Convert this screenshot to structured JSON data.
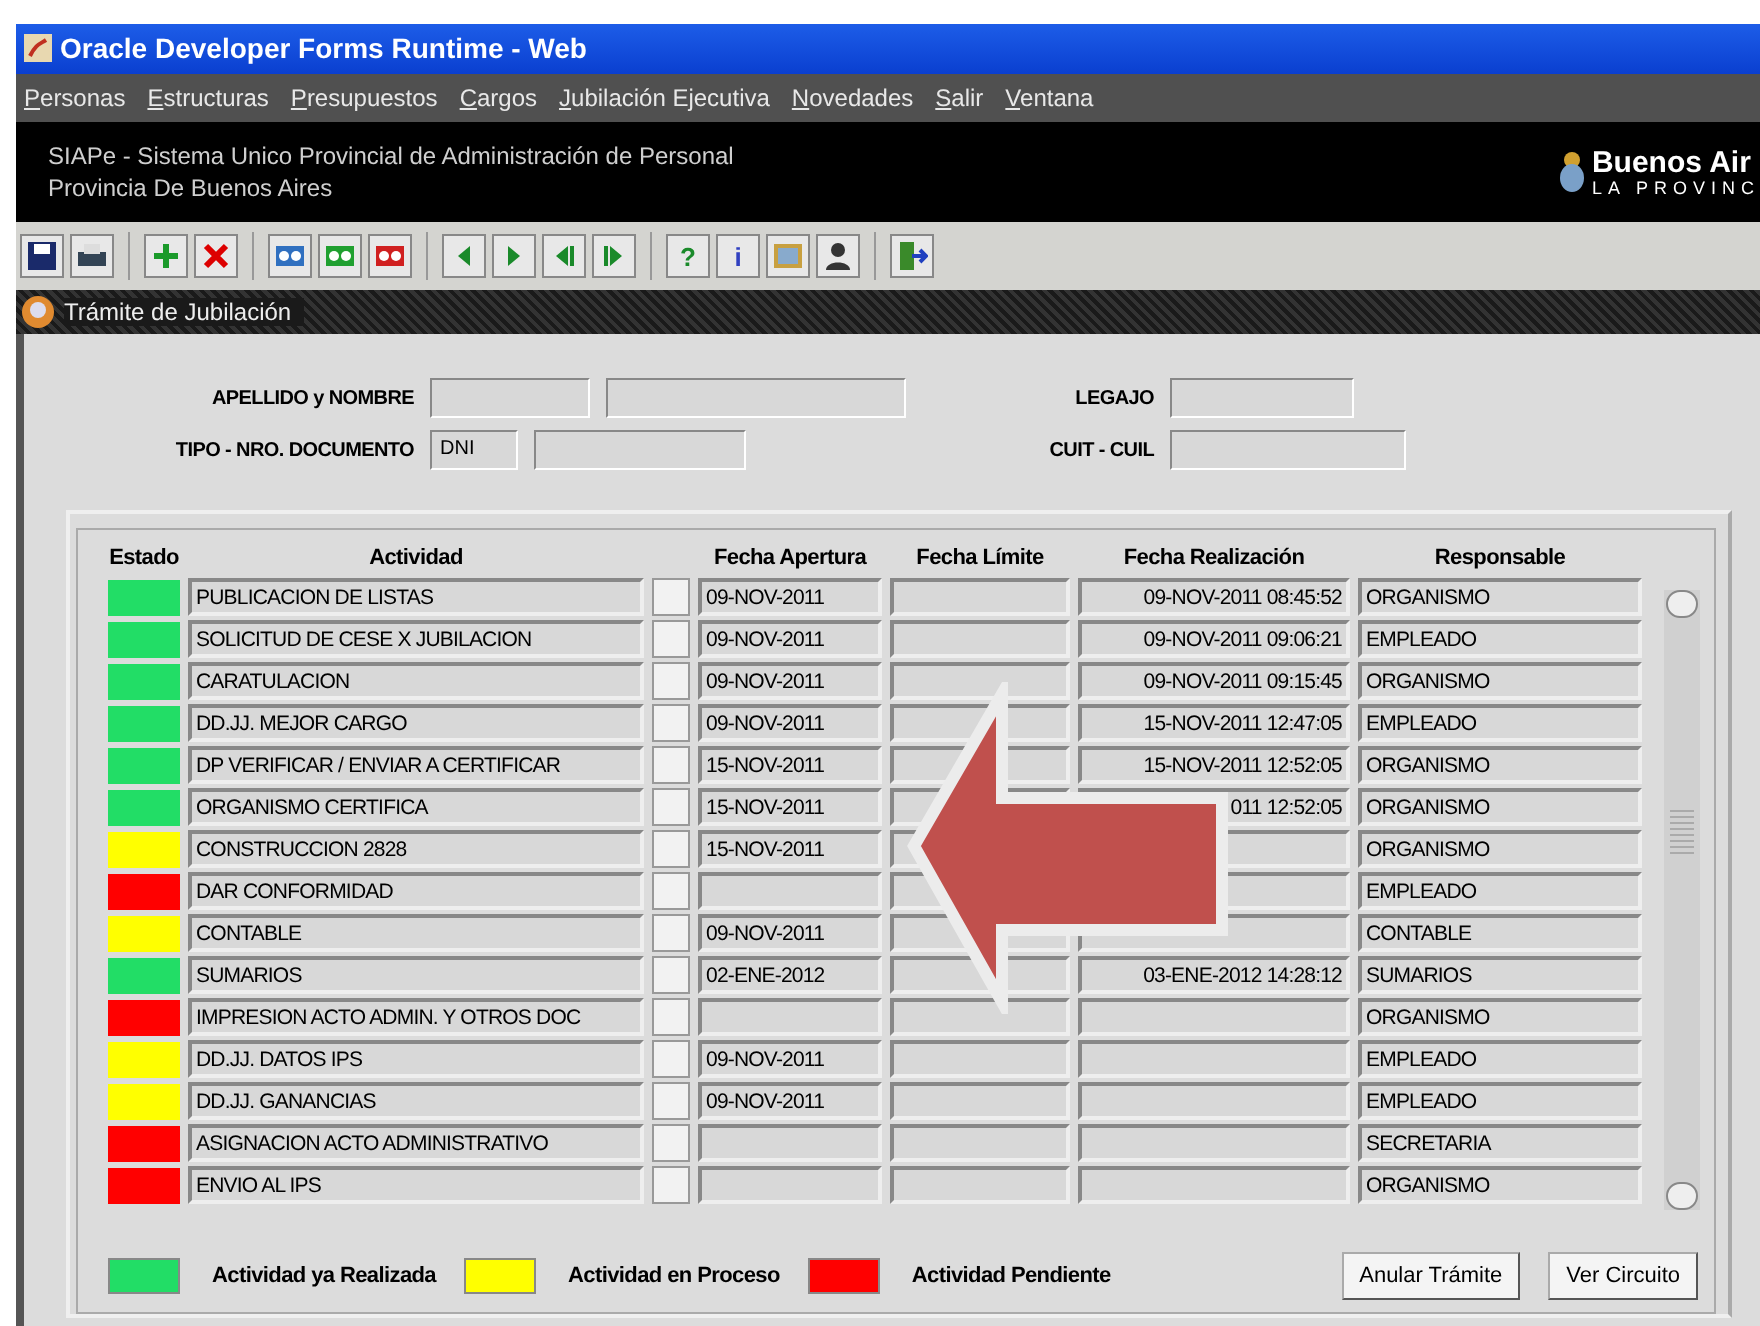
{
  "window": {
    "title": "Oracle Developer Forms Runtime - Web"
  },
  "menu": [
    "Personas",
    "Estructuras",
    "Presupuestos",
    "Cargos",
    "Jubilación Ejecutiva",
    "Novedades",
    "Salir",
    "Ventana"
  ],
  "header": {
    "line1": "SIAPe - Sistema Unico Provincial de Administración de Personal",
    "line2": "Provincia De Buenos Aires",
    "logo_line1": "Buenos Air",
    "logo_line2": "LA PROVINC"
  },
  "toolbar": [
    {
      "kind": "save"
    },
    {
      "kind": "print"
    },
    {
      "kind": "sep"
    },
    {
      "kind": "add"
    },
    {
      "kind": "delete"
    },
    {
      "kind": "sep"
    },
    {
      "kind": "query"
    },
    {
      "kind": "query-green"
    },
    {
      "kind": "query-red"
    },
    {
      "kind": "sep"
    },
    {
      "kind": "first"
    },
    {
      "kind": "next"
    },
    {
      "kind": "prev-block"
    },
    {
      "kind": "next-block"
    },
    {
      "kind": "sep"
    },
    {
      "kind": "help",
      "glyph": "?"
    },
    {
      "kind": "info",
      "glyph": "i"
    },
    {
      "kind": "image"
    },
    {
      "kind": "person"
    },
    {
      "kind": "sep"
    },
    {
      "kind": "exit"
    }
  ],
  "form": {
    "title": "Trámite de Jubilación",
    "fields": {
      "apellido_label": "APELLIDO y NOMBRE",
      "documento_label": "TIPO - NRO. DOCUMENTO",
      "tipo_documento": "DNI",
      "legajo_label": "LEGAJO",
      "cuit_label": "CUIT - CUIL"
    },
    "table": {
      "columns": [
        "Estado",
        "Actividad",
        "Fecha Apertura",
        "Fecha Límite",
        "Fecha Realización",
        "Responsable"
      ],
      "rows": [
        {
          "color": "#22dd66",
          "actividad": "PUBLICACION DE LISTAS",
          "apertura": "09-NOV-2011",
          "limite": "",
          "realizacion": "09-NOV-2011 08:45:52",
          "responsable": "ORGANISMO"
        },
        {
          "color": "#22dd66",
          "actividad": "SOLICITUD DE CESE X JUBILACION",
          "apertura": "09-NOV-2011",
          "limite": "",
          "realizacion": "09-NOV-2011 09:06:21",
          "responsable": "EMPLEADO"
        },
        {
          "color": "#22dd66",
          "actividad": "CARATULACION",
          "apertura": "09-NOV-2011",
          "limite": "",
          "realizacion": "09-NOV-2011 09:15:45",
          "responsable": "ORGANISMO"
        },
        {
          "color": "#22dd66",
          "actividad": "DD.JJ. MEJOR CARGO",
          "apertura": "09-NOV-2011",
          "limite": "",
          "realizacion": "15-NOV-2011 12:47:05",
          "responsable": "EMPLEADO"
        },
        {
          "color": "#22dd66",
          "actividad": "DP VERIFICAR / ENVIAR A CERTIFICAR",
          "apertura": "15-NOV-2011",
          "limite": "",
          "realizacion": "15-NOV-2011 12:52:05",
          "responsable": "ORGANISMO"
        },
        {
          "color": "#22dd66",
          "actividad": "ORGANISMO CERTIFICA",
          "apertura": "15-NOV-2011",
          "limite": "",
          "realizacion": "011 12:52:05",
          "responsable": "ORGANISMO"
        },
        {
          "color": "#ffff00",
          "actividad": "CONSTRUCCION 2828",
          "apertura": "15-NOV-2011",
          "limite": "",
          "realizacion": "",
          "responsable": "ORGANISMO"
        },
        {
          "color": "#ff0000",
          "actividad": "DAR CONFORMIDAD",
          "apertura": "",
          "limite": "",
          "realizacion": "",
          "responsable": "EMPLEADO"
        },
        {
          "color": "#ffff00",
          "actividad": "CONTABLE",
          "apertura": "09-NOV-2011",
          "limite": "",
          "realizacion": "",
          "responsable": "CONTABLE"
        },
        {
          "color": "#22dd66",
          "actividad": "SUMARIOS",
          "apertura": "02-ENE-2012",
          "limite": "",
          "realizacion": "03-ENE-2012 14:28:12",
          "responsable": "SUMARIOS"
        },
        {
          "color": "#ff0000",
          "actividad": "IMPRESION ACTO ADMIN. Y OTROS DOC",
          "apertura": "",
          "limite": "",
          "realizacion": "",
          "responsable": "ORGANISMO"
        },
        {
          "color": "#ffff00",
          "actividad": "DD.JJ. DATOS IPS",
          "apertura": "09-NOV-2011",
          "limite": "",
          "realizacion": "",
          "responsable": "EMPLEADO"
        },
        {
          "color": "#ffff00",
          "actividad": "DD.JJ. GANANCIAS",
          "apertura": "09-NOV-2011",
          "limite": "",
          "realizacion": "",
          "responsable": "EMPLEADO"
        },
        {
          "color": "#ff0000",
          "actividad": "ASIGNACION ACTO ADMINISTRATIVO",
          "apertura": "",
          "limite": "",
          "realizacion": "",
          "responsable": "SECRETARIA"
        },
        {
          "color": "#ff0000",
          "actividad": "ENVIO AL IPS",
          "apertura": "",
          "limite": "",
          "realizacion": "",
          "responsable": "ORGANISMO"
        }
      ]
    },
    "legend": [
      {
        "color": "#22dd66",
        "label": "Actividad ya Realizada"
      },
      {
        "color": "#ffff00",
        "label": "Actividad en Proceso"
      },
      {
        "color": "#ff0000",
        "label": "Actividad Pendiente"
      }
    ],
    "buttons": [
      "Anular Trámite",
      "Ver Circuito"
    ]
  },
  "callout": {
    "kind": "arrow-left"
  }
}
